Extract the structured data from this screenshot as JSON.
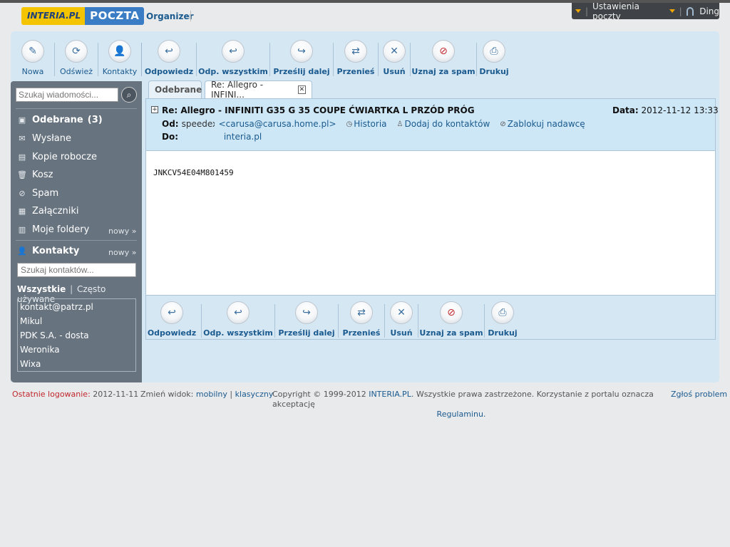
{
  "header": {
    "logo_interia": "INTERIA.PL",
    "logo_poczta": "POCZTA",
    "organizer": "Organizer",
    "settings": "Ustawienia poczty",
    "user": "Ding"
  },
  "toolbar_top": {
    "nowa": "Nowa",
    "odswiez": "Odśwież",
    "kontakty": "Kontakty",
    "odpowiedz": "Odpowiedz",
    "odp_wszystkim": "Odp. wszystkim",
    "przeslij": "Prześlij dalej",
    "przenies": "Przenieś",
    "usun": "Usuń",
    "spam": "Uznaj za spam",
    "drukuj": "Drukuj"
  },
  "sidebar": {
    "search_placeholder": "Szukaj wiadomości...",
    "folders": {
      "odebrane": "Odebrane",
      "odebrane_count": "(3)",
      "wyslane": "Wysłane",
      "kopie": "Kopie robocze",
      "kosz": "Kosz",
      "spam": "Spam",
      "zalaczniki": "Załączniki",
      "moje_foldery": "Moje foldery",
      "nowy": "nowy »"
    },
    "kontakty_title": "Kontakty",
    "kontakty_nowy": "nowy »",
    "kontakty_search_placeholder": "Szukaj kontaktów...",
    "filter_all": "Wszystkie",
    "filter_sep": "|",
    "filter_frequent": "Często używane",
    "contacts": [
      "kontakt@patrz.pl",
      "Mikul",
      "PDK S.A. - dosta",
      "Weronika",
      "Wixa"
    ]
  },
  "tabs": {
    "inbox": "Odebrane",
    "message": "Re: Allegro - INFINI..."
  },
  "message": {
    "subject": "Re: Allegro - INFINITI G35 G 35 COUPE ĆWIARTKA L PRZÓD PRÓG",
    "date_label": "Data:",
    "date_value": "2012-11-12 13:33",
    "from_label": "Od:",
    "from_name": "speedex",
    "from_email": "<carusa@carusa.home.pl>",
    "historia": "Historia",
    "dodaj": "Dodaj do kontaktów",
    "zablokuj": "Zablokuj nadawcę",
    "to_label": "Do:",
    "to_value": "interia.pl",
    "body": "JNKCV54E04M801459"
  },
  "footer": {
    "last_login_label": "Ostatnie logowanie:",
    "last_login_value": "2012-11-11",
    "view_label": "Zmień widok:",
    "mobile": "mobilny",
    "sep": "|",
    "classic": "klasyczny",
    "copyright": "Copyright © 1999-2012",
    "interia": "INTERIA.PL",
    "rights": ". Wszystkie prawa zastrzeżone. Korzystanie z portalu oznacza akceptację",
    "regulamin": "Regulaminu.",
    "report": "Zgłoś problem"
  }
}
